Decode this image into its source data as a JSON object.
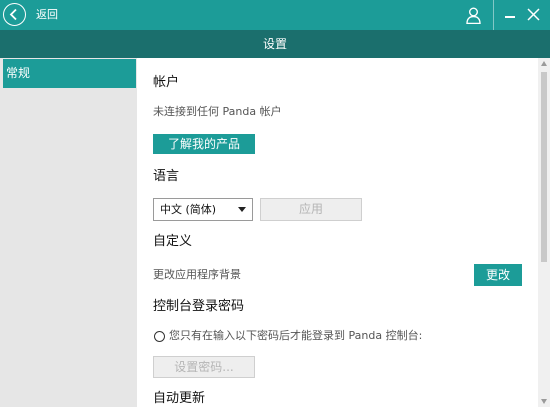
{
  "titlebar": {
    "back_label": "返回",
    "back_icon": "back-arrow-icon",
    "user_icon": "user-icon",
    "minimize_icon": "minimize-icon",
    "close_icon": "close-icon"
  },
  "header": {
    "title": "设置"
  },
  "sidebar": {
    "items": [
      {
        "label": "常规",
        "selected": true
      }
    ]
  },
  "account": {
    "title": "帐户",
    "status": "未连接到任何 Panda 帐户",
    "learn_button": "了解我的产品"
  },
  "language": {
    "title": "语言",
    "selected": "中文 (简体)",
    "apply_button": "应用"
  },
  "customize": {
    "title": "自定义",
    "desc": "更改应用程序背景",
    "change_button": "更改"
  },
  "console_password": {
    "title": "控制台登录密码",
    "option_label": "您只有在输入以下密码后才能登录到 Panda 控制台:",
    "set_password_button": "设置密码..."
  },
  "auto_update": {
    "title": "自动更新"
  },
  "colors": {
    "accent": "#1c9c98",
    "header_dark": "#1b6f6d",
    "sidebar_bg": "#e6e6e6"
  }
}
